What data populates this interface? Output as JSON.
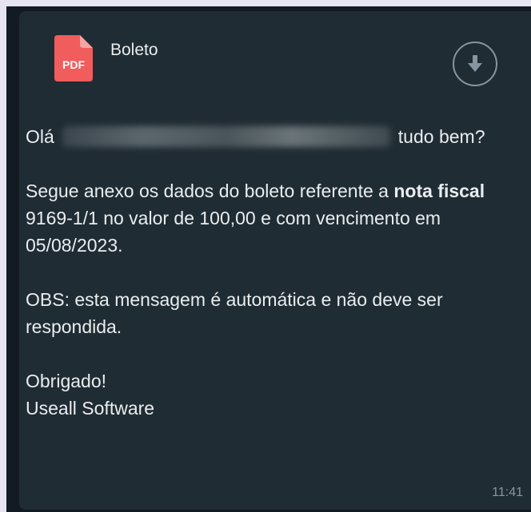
{
  "attachment": {
    "icon_label": "PDF",
    "file_name": "Boleto"
  },
  "message": {
    "greeting_prefix": "Olá",
    "greeting_suffix": "tudo bem?",
    "body_part1": "Segue anexo os dados do boleto referente a ",
    "body_bold": "nota fiscal",
    "body_part2": " 9169-1/1 no valor de 100,00 e com vencimento em 05/08/2023.",
    "obs": "OBS: esta mensagem é automática e não deve ser respondida.",
    "thanks": "Obrigado!",
    "signature": "Useall Software"
  },
  "timestamp": "11:41",
  "colors": {
    "bubble": "#202c33",
    "text": "#e9edef",
    "meta": "#8696a0",
    "pdf_red": "#f15c5c"
  }
}
